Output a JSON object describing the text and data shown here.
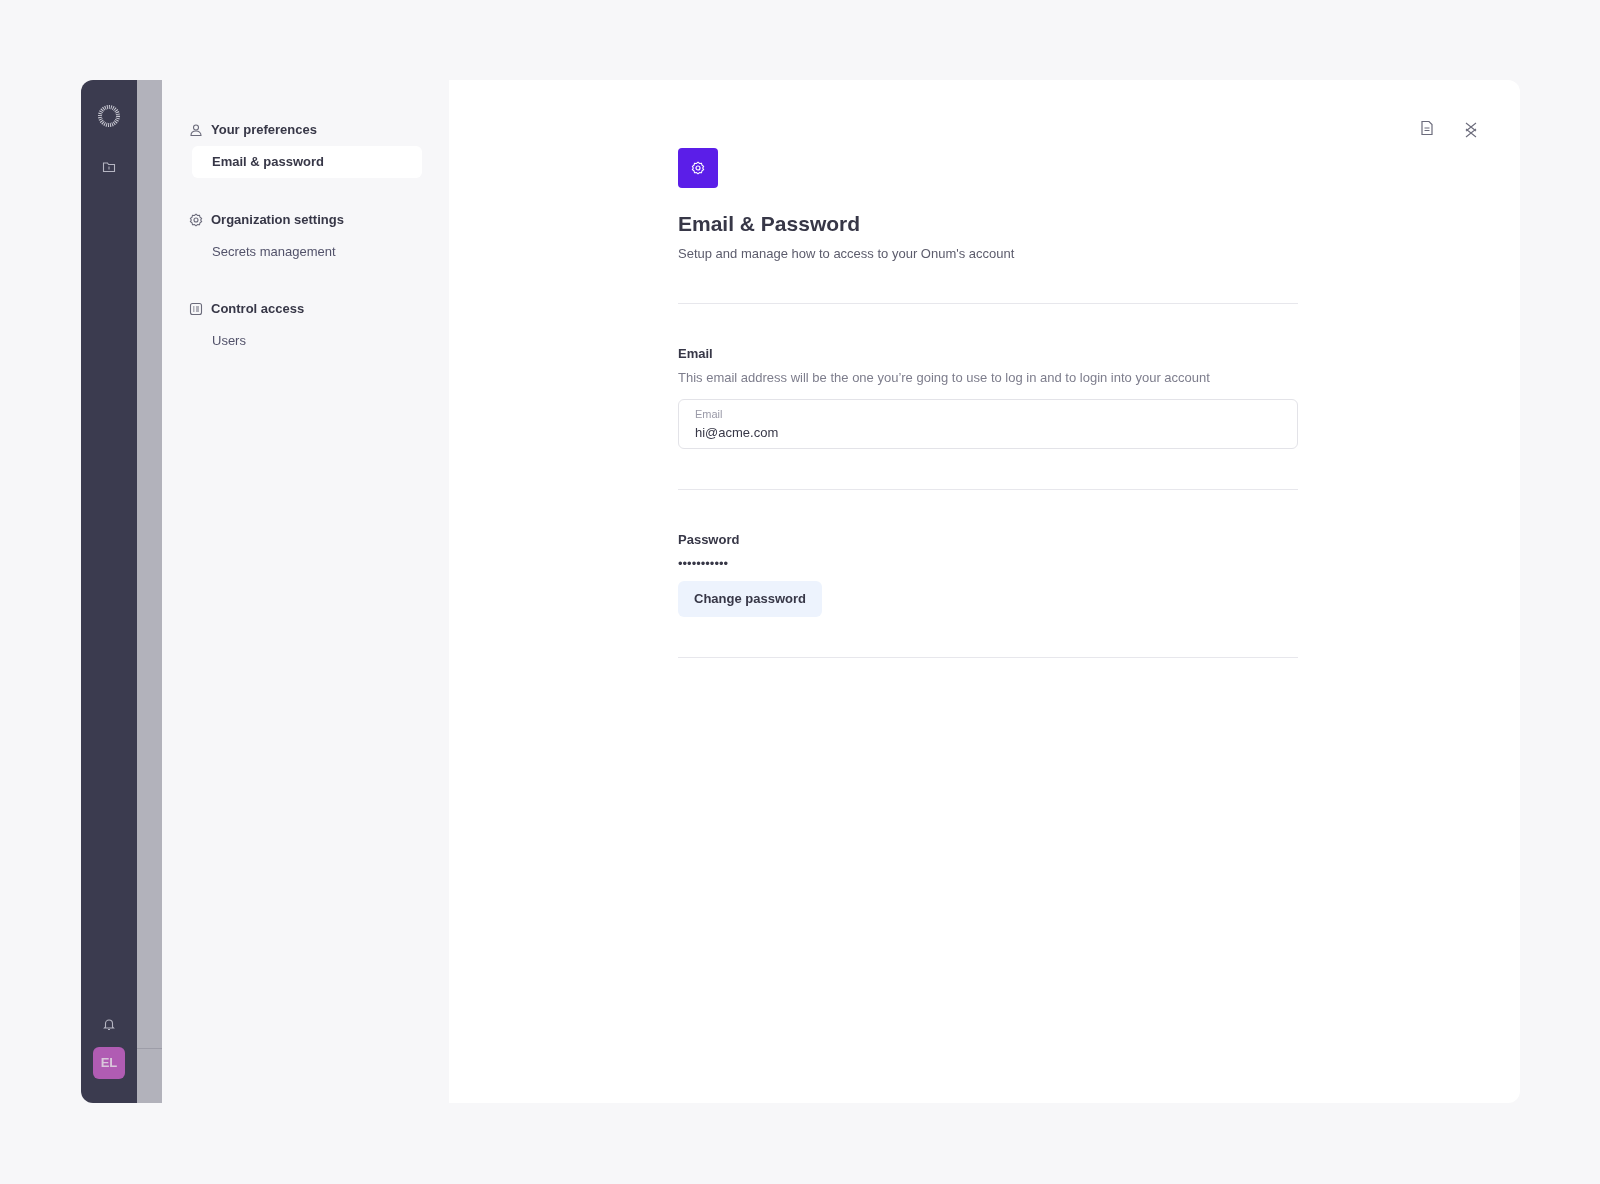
{
  "rail": {
    "avatar": "EL"
  },
  "nav": [
    {
      "title": "Your preferences",
      "items": [
        {
          "label": "Email & password",
          "selected": true
        }
      ]
    },
    {
      "title": "Organization settings",
      "items": [
        {
          "label": "Secrets management",
          "selected": false
        }
      ]
    },
    {
      "title": "Control access",
      "items": [
        {
          "label": "Users",
          "selected": false
        }
      ]
    }
  ],
  "page": {
    "title": "Email & Password",
    "subtitle": "Setup and manage how to access to your Onum's account"
  },
  "email": {
    "heading": "Email",
    "description": "This email address will be the one you’re going to use to log in and to login into your account",
    "field_label": "Email",
    "value": "hi@acme.com"
  },
  "password": {
    "heading": "Password",
    "masked": "•••••••••••",
    "button": "Change password"
  }
}
